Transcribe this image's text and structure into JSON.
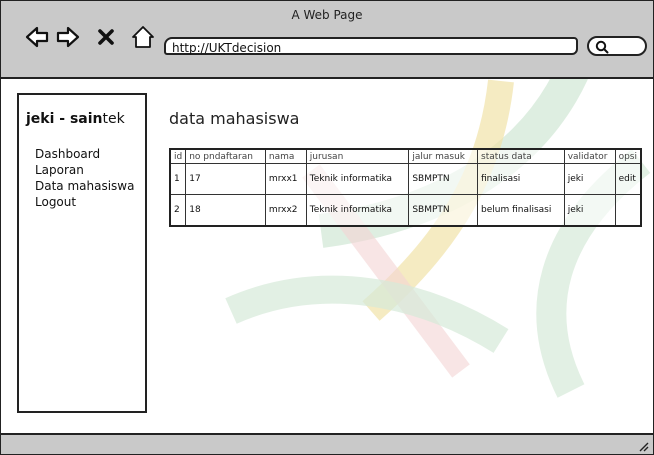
{
  "window": {
    "title": "A Web Page"
  },
  "toolbar": {
    "back_icon": "arrow-left-icon",
    "forward_icon": "arrow-right-icon",
    "stop_icon": "close-icon",
    "home_icon": "home-icon",
    "url": "http://UKTdecision",
    "search_icon": "search-icon"
  },
  "sidebar": {
    "brand": {
      "part1": "jeki - sain",
      "part2": "tek"
    },
    "items": [
      {
        "label": "Dashboard"
      },
      {
        "label": "Laporan"
      },
      {
        "label": "Data mahasiswa"
      },
      {
        "label": "Logout"
      }
    ]
  },
  "main": {
    "title": "data mahasiswa",
    "table": {
      "headers": [
        "id",
        "no pndaftaran",
        "nama",
        "jurusan",
        "jalur masuk",
        "status data",
        "validator",
        "opsi"
      ],
      "rows": [
        [
          "1",
          "17",
          "mrxx1",
          "Teknik informatika",
          "SBMPTN",
          "finalisasi",
          "jeki",
          "edit"
        ],
        [
          "2",
          "18",
          "mrxx2",
          "Teknik informatika",
          "SBMPTN",
          "belum finalisasi",
          "jeki",
          ""
        ]
      ]
    }
  },
  "colors": {
    "chrome_gray": "#c9c9c9",
    "border": "#222222",
    "watermark_green": "#cfe6d5",
    "watermark_gold": "#f0dd9a",
    "watermark_red": "#f2d2d2"
  }
}
